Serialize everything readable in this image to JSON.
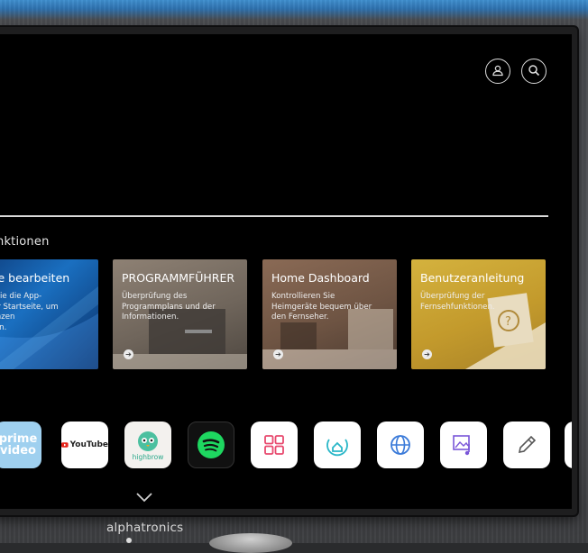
{
  "brand": "alphatronics",
  "section_title": "nktionen",
  "cards": [
    {
      "title": "tseite bearbeiten",
      "desc": "eiten Sie die App-\nauf der Startseite, um\nräferenzen\nzufügen."
    },
    {
      "title": "PROGRAMMFÜHRER",
      "desc": "Überprüfung des\nProgrammplans und der\nInformationen."
    },
    {
      "title": "Home Dashboard",
      "desc": "Kontrollieren Sie\nHeimgeräte bequem über\nden Fernseher."
    },
    {
      "title": "Benutzeranleitung",
      "desc": "Überprüfung der\nFernsehfunktionen."
    }
  ],
  "apps": [
    {
      "name": "prime-video-icon",
      "line1": "prime",
      "line2": "video"
    },
    {
      "name": "youtube-icon",
      "label": "YouTube"
    },
    {
      "name": "highbrow-icon",
      "label": "highbrow"
    },
    {
      "name": "spotify-icon"
    },
    {
      "name": "apps-grid-icon"
    },
    {
      "name": "home-icon"
    },
    {
      "name": "globe-icon"
    },
    {
      "name": "music-photo-icon"
    },
    {
      "name": "edit-pencil-icon"
    }
  ],
  "colors": {
    "accent_pink": "#e8496e",
    "accent_cyan": "#2ab7c8",
    "accent_blue": "#3a7ad9",
    "accent_purple": "#7a56d8",
    "spotify_green": "#1ed760",
    "prime_blue": "#8ec5ea"
  }
}
